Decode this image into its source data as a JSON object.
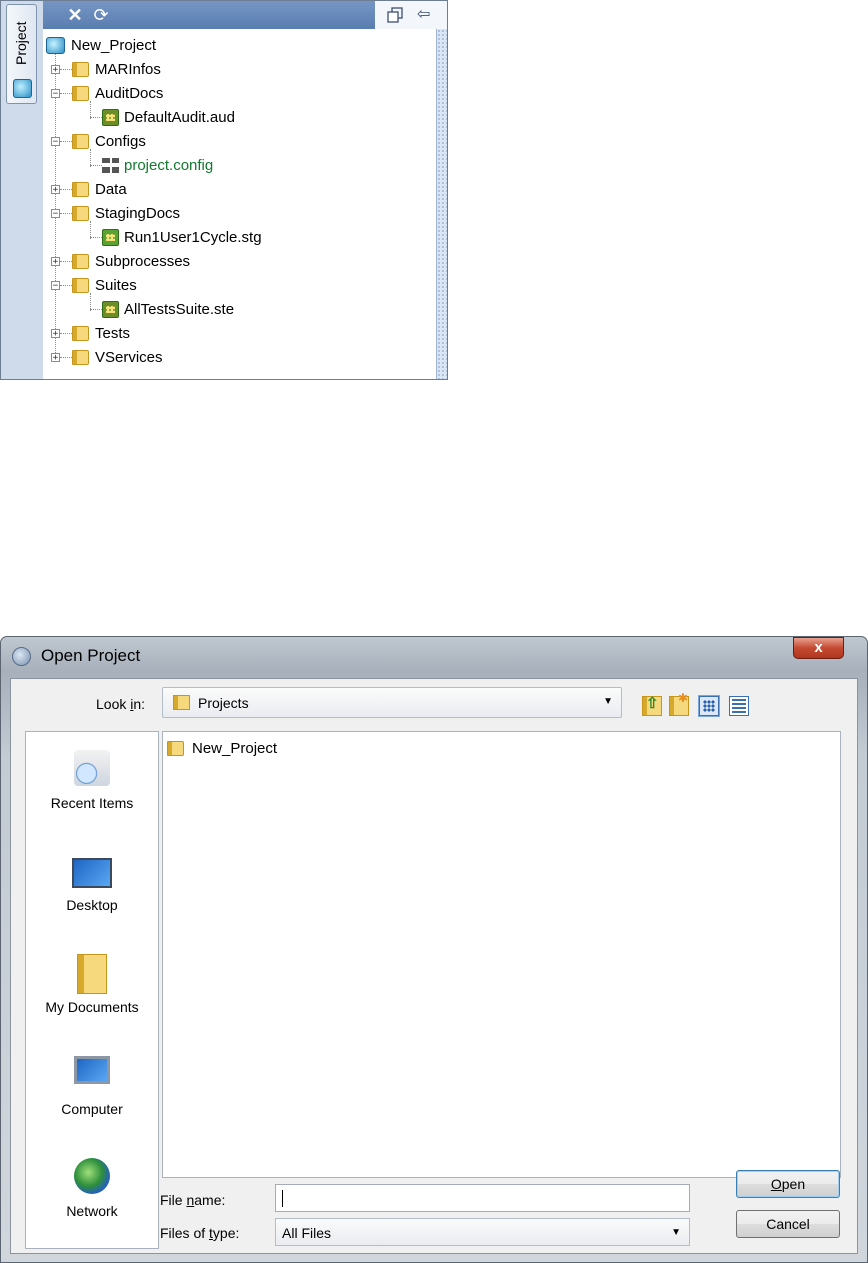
{
  "project_panel": {
    "side_tab_label": "Project",
    "tree": {
      "root": "New_Project",
      "items": [
        {
          "label": "MARInfos",
          "type": "folder",
          "expanded": false
        },
        {
          "label": "AuditDocs",
          "type": "folder",
          "expanded": true
        },
        {
          "label": "DefaultAudit.aud",
          "type": "audit-file"
        },
        {
          "label": "Configs",
          "type": "folder",
          "expanded": true
        },
        {
          "label": "project.config",
          "type": "config-file"
        },
        {
          "label": "Data",
          "type": "folder",
          "expanded": false
        },
        {
          "label": "StagingDocs",
          "type": "folder",
          "expanded": true
        },
        {
          "label": "Run1User1Cycle.stg",
          "type": "staging-file"
        },
        {
          "label": "Subprocesses",
          "type": "folder",
          "expanded": false
        },
        {
          "label": "Suites",
          "type": "folder",
          "expanded": true
        },
        {
          "label": "AllTestsSuite.ste",
          "type": "suite-file"
        },
        {
          "label": "Tests",
          "type": "folder",
          "expanded": false
        },
        {
          "label": "VServices",
          "type": "folder",
          "expanded": false
        }
      ]
    },
    "config_label_color": "#127a2f"
  },
  "dialog": {
    "title": "Open Project",
    "close_glyph": "x",
    "look_in_label_pre": "Look ",
    "look_in_label_u": "i",
    "look_in_label_post": "n:",
    "look_in_value": "Projects",
    "places": [
      {
        "label": "Recent Items",
        "icon": "recent-items-icon"
      },
      {
        "label": "Desktop",
        "icon": "desktop-icon"
      },
      {
        "label": "My Documents",
        "icon": "my-documents-icon"
      },
      {
        "label": "Computer",
        "icon": "computer-icon"
      },
      {
        "label": "Network",
        "icon": "network-icon"
      }
    ],
    "files": [
      "New_Project"
    ],
    "file_name_label_pre": "File ",
    "file_name_label_u": "n",
    "file_name_label_post": "ame:",
    "file_name_value": "",
    "files_of_type_label_pre": "Files of ",
    "files_of_type_label_u": "t",
    "files_of_type_label_post": "ype:",
    "files_of_type_value": "All Files",
    "open_button_u": "O",
    "open_button_post": "pen",
    "cancel_button": "Cancel"
  }
}
